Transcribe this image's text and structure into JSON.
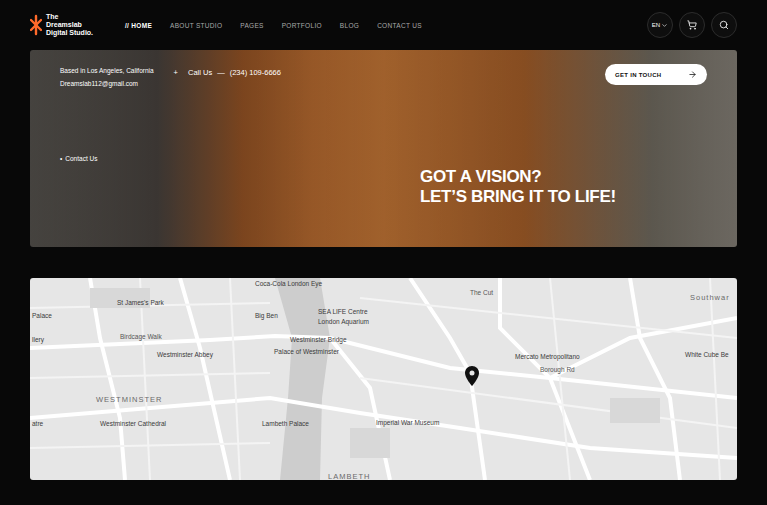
{
  "header": {
    "logo": [
      "The",
      "Dreamslab",
      "Digital Studio."
    ],
    "nav": [
      {
        "label": "// HOME",
        "selected": true
      },
      {
        "label": "ABOUT STUDIO",
        "selected": false
      },
      {
        "label": "PAGES",
        "selected": false
      },
      {
        "label": "PORTFOLIO",
        "selected": false
      },
      {
        "label": "BLOG",
        "selected": false
      },
      {
        "label": "CONTACT US",
        "selected": false
      }
    ],
    "language": "EN"
  },
  "hero": {
    "location": "Based in Los Angeles, California",
    "email": "Dreamslab112@gmail.com",
    "plus": "+",
    "call_label": "Call Us",
    "dash": "—",
    "phone": "(234) 109-6666",
    "cta": "GET IN TOUCH",
    "bullet": "•",
    "contact_link": "Contact Us",
    "headline": [
      "GOT A VISION?",
      "LET’S BRING IT TO LIFE!"
    ]
  },
  "map": {
    "labels": [
      {
        "text": "Coca-Cola London Eye",
        "kind": "place"
      },
      {
        "text": "St James's Park",
        "kind": "place"
      },
      {
        "text": "Palace",
        "kind": "place"
      },
      {
        "text": "Big Ben",
        "kind": "place"
      },
      {
        "text": "SEA LIFE Centre",
        "kind": "place"
      },
      {
        "text": "London Aquarium",
        "kind": "place"
      },
      {
        "text": "Westminster Bridge",
        "kind": "place"
      },
      {
        "text": "Birdcage Walk",
        "kind": "road"
      },
      {
        "text": "Westminster Abbey",
        "kind": "place"
      },
      {
        "text": "Palace of Westminster",
        "kind": "place"
      },
      {
        "text": "WESTMINSTER",
        "kind": "area"
      },
      {
        "text": "Westminster Cathedral",
        "kind": "place"
      },
      {
        "text": "Lambeth Palace",
        "kind": "place"
      },
      {
        "text": "Imperial War Museum",
        "kind": "place"
      },
      {
        "text": "Mercato Metropolitano",
        "kind": "place"
      },
      {
        "text": "Borough Rd",
        "kind": "road"
      },
      {
        "text": "White Cube Be",
        "kind": "place"
      },
      {
        "text": "Southwar",
        "kind": "area"
      },
      {
        "text": "The Cut",
        "kind": "road"
      },
      {
        "text": "LAMBETH",
        "kind": "area"
      },
      {
        "text": "atre",
        "kind": "place"
      },
      {
        "text": "llery",
        "kind": "place"
      }
    ]
  }
}
